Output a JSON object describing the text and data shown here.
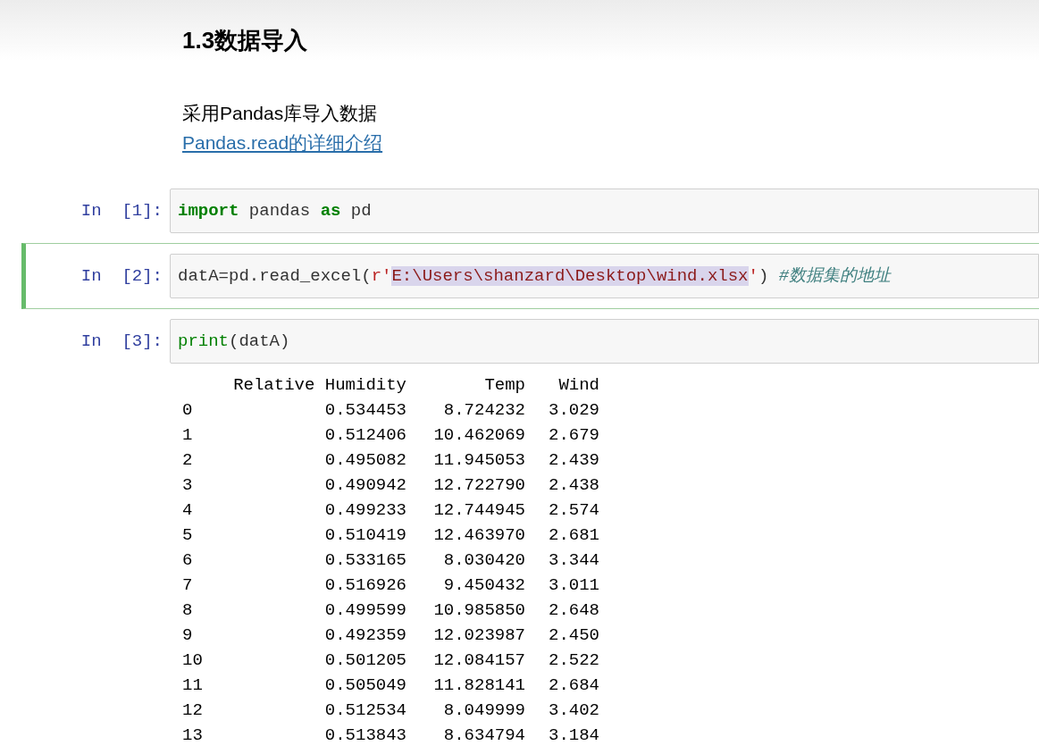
{
  "cells": [
    {
      "kind": "markdown",
      "heading": "1.3数据导入",
      "paragraph": "采用Pandas库导入数据",
      "link": "Pandas.read的详细介绍"
    },
    {
      "kind": "code",
      "prompt": "In  [1]:",
      "selected": false,
      "tokens": [
        {
          "kind": "keyword",
          "text": "import"
        },
        {
          "kind": "plain",
          "text": " pandas "
        },
        {
          "kind": "keyword",
          "text": "as"
        },
        {
          "kind": "plain",
          "text": " pd"
        }
      ]
    },
    {
      "kind": "code",
      "prompt": "In  [2]:",
      "selected": true,
      "tokens": [
        {
          "kind": "plain",
          "text": "datA=pd.read_excel("
        },
        {
          "kind": "string",
          "text": "r'"
        },
        {
          "kind": "highlight",
          "text": "E:\\Users\\shanzard\\Desktop\\wind.xlsx"
        },
        {
          "kind": "string",
          "text": "'"
        },
        {
          "kind": "plain",
          "text": ") "
        },
        {
          "kind": "comment",
          "text": "#数据集的地址"
        }
      ]
    },
    {
      "kind": "code",
      "prompt": "In  [3]:",
      "selected": false,
      "tokens": [
        {
          "kind": "builtin",
          "text": "print"
        },
        {
          "kind": "plain",
          "text": "(datA)"
        }
      ],
      "output": {
        "columns": [
          "",
          "Relative Humidity",
          "Temp",
          "Wind"
        ],
        "rows": [
          [
            "0",
            "0.534453",
            "8.724232",
            "3.029"
          ],
          [
            "1",
            "0.512406",
            "10.462069",
            "2.679"
          ],
          [
            "2",
            "0.495082",
            "11.945053",
            "2.439"
          ],
          [
            "3",
            "0.490942",
            "12.722790",
            "2.438"
          ],
          [
            "4",
            "0.499233",
            "12.744945",
            "2.574"
          ],
          [
            "5",
            "0.510419",
            "12.463970",
            "2.681"
          ],
          [
            "6",
            "0.533165",
            "8.030420",
            "3.344"
          ],
          [
            "7",
            "0.516926",
            "9.450432",
            "3.011"
          ],
          [
            "8",
            "0.499599",
            "10.985850",
            "2.648"
          ],
          [
            "9",
            "0.492359",
            "12.023987",
            "2.450"
          ],
          [
            "10",
            "0.501205",
            "12.084157",
            "2.522"
          ],
          [
            "11",
            "0.505049",
            "11.828141",
            "2.684"
          ],
          [
            "12",
            "0.512534",
            "8.049999",
            "3.402"
          ],
          [
            "13",
            "0.513843",
            "8.634794",
            "3.184"
          ]
        ]
      }
    }
  ]
}
